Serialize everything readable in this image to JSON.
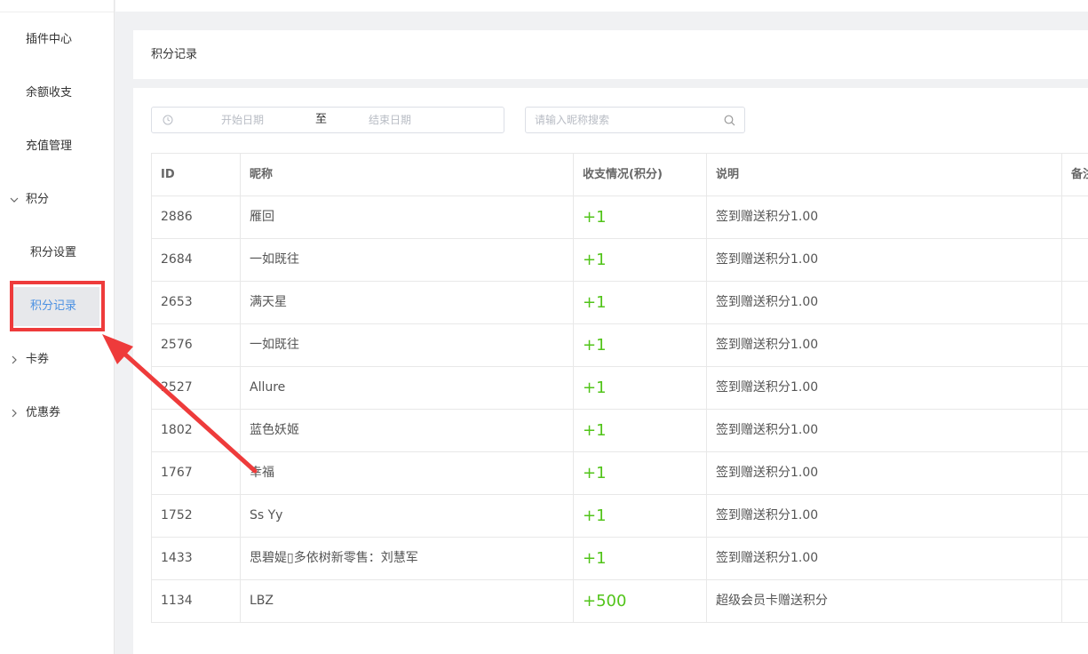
{
  "sidebar": {
    "items": [
      {
        "label": "插件中心"
      },
      {
        "label": "余额收支"
      },
      {
        "label": "充值管理"
      },
      {
        "label": "积分",
        "chevron": "chevron-down-icon"
      },
      {
        "label": "积分设置"
      },
      {
        "label": "积分记录",
        "active": true
      },
      {
        "label": "卡券",
        "chevron": "chevron-right-icon"
      },
      {
        "label": "优惠券",
        "chevron": "chevron-right-icon"
      }
    ]
  },
  "page": {
    "title": "积分记录"
  },
  "filters": {
    "date_start_placeholder": "开始日期",
    "date_separator": "至",
    "date_end_placeholder": "结束日期",
    "search_placeholder": "请输入昵称搜索"
  },
  "table": {
    "headers": [
      "ID",
      "昵称",
      "收支情况(积分)",
      "说明",
      "备注"
    ],
    "rows": [
      {
        "id": "2886",
        "nickname": "雁回",
        "points": "+1",
        "desc": "签到赠送积分1.00"
      },
      {
        "id": "2684",
        "nickname": "一如既往",
        "points": "+1",
        "desc": "签到赠送积分1.00"
      },
      {
        "id": "2653",
        "nickname": "满天星",
        "points": "+1",
        "desc": "签到赠送积分1.00"
      },
      {
        "id": "2576",
        "nickname": "一如既往",
        "points": "+1",
        "desc": "签到赠送积分1.00"
      },
      {
        "id": "2527",
        "nickname": "Allure",
        "points": "+1",
        "desc": "签到赠送积分1.00"
      },
      {
        "id": "1802",
        "nickname": "蓝色妖姬",
        "points": "+1",
        "desc": "签到赠送积分1.00"
      },
      {
        "id": "1767",
        "nickname": "幸福",
        "points": "+1",
        "desc": "签到赠送积分1.00"
      },
      {
        "id": "1752",
        "nickname": "Ss Yy",
        "points": "+1",
        "desc": "签到赠送积分1.00"
      },
      {
        "id": "1433",
        "nickname": "思碧媞▯多依树新零售：刘慧军",
        "points": "+1",
        "desc": "签到赠送积分1.00"
      },
      {
        "id": "1134",
        "nickname": "LBZ",
        "points": "+500",
        "desc": "超级会员卡赠送积分"
      }
    ]
  },
  "colors": {
    "accent": "#4a90e2",
    "positive": "#52c41a",
    "annotation": "#ee3b3b"
  }
}
